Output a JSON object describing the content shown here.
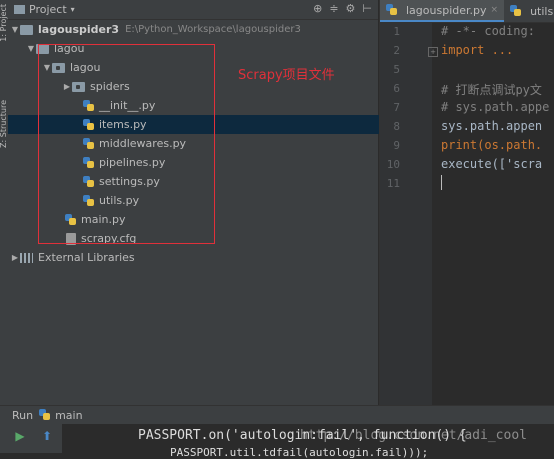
{
  "side_strip": {
    "labels": [
      "1: Project",
      "Z: Structure"
    ]
  },
  "project_panel": {
    "title": "Project",
    "tools": [
      "⊕",
      "≑",
      "⚙",
      "⊢"
    ],
    "root": {
      "name": "lagouspider3",
      "path": "E:\\Python_Workspace\\lagouspider3"
    },
    "tree": [
      {
        "label": "lagou"
      },
      {
        "label": "lagou"
      },
      {
        "label": "spiders"
      },
      {
        "label": "__init__.py"
      },
      {
        "label": "items.py"
      },
      {
        "label": "middlewares.py"
      },
      {
        "label": "pipelines.py"
      },
      {
        "label": "settings.py"
      },
      {
        "label": "utils.py"
      },
      {
        "label": "main.py"
      },
      {
        "label": "scrapy.cfg"
      },
      {
        "label": "External Libraries"
      }
    ],
    "annotation": "Scrapy项目文件"
  },
  "editor": {
    "tabs": [
      {
        "label": "lagouspider.py"
      },
      {
        "label": "utils.py"
      }
    ],
    "line_numbers": [
      "1",
      "2",
      "5",
      "6",
      "7",
      "8",
      "9",
      "10",
      "11"
    ],
    "lines": [
      "# -*- coding: ",
      "import ...",
      "",
      "# 打断点调试py文",
      "# sys.path.appe",
      "sys.path.appen",
      "print(os.path.",
      "execute(['scra",
      ""
    ]
  },
  "run_panel": {
    "title": "Run",
    "config": "main",
    "console_line1": "PASSPORT.on('autologin:fail', function() {",
    "console_line2": "PASSPORT.util.tdfail(autologin.fail)));",
    "watermark": "http://blog.csdn.net/adi_cool"
  },
  "colors": {
    "annotation": "#e0303a",
    "selection": "#0d293e"
  }
}
